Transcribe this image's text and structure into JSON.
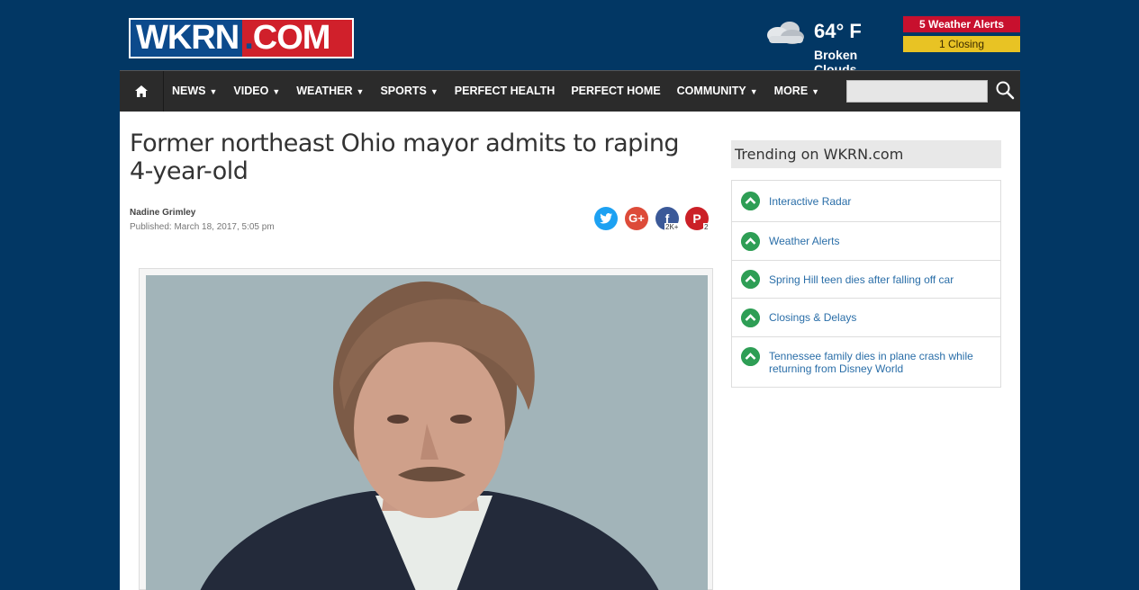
{
  "header": {
    "logo_left": "WKRN",
    "logo_dot": ".",
    "logo_right": "COM",
    "weather_icon": "cloud-icon",
    "temperature": "64° F",
    "condition": "Broken Clouds",
    "alerts_label": "5 Weather Alerts",
    "closings_label": "1 Closing"
  },
  "nav": {
    "home_icon": "home-icon",
    "items": [
      {
        "label": "NEWS",
        "caret": "▼"
      },
      {
        "label": "VIDEO",
        "caret": "▼"
      },
      {
        "label": "WEATHER",
        "caret": "▼"
      },
      {
        "label": "SPORTS",
        "caret": "▼"
      },
      {
        "label": "PERFECT HEALTH",
        "caret": ""
      },
      {
        "label": "PERFECT HOME",
        "caret": ""
      },
      {
        "label": "COMMUNITY",
        "caret": "▼"
      },
      {
        "label": "MORE",
        "caret": "▼"
      }
    ],
    "search_placeholder": "",
    "search_icon": "search-icon"
  },
  "article": {
    "headline": "Former northeast Ohio mayor admits to raping 4-year-old",
    "author": "Nadine Grimley",
    "published": "Published: March 18, 2017, 5:05 pm",
    "share": {
      "twitter": "twitter-icon",
      "google_plus": "G+",
      "facebook": "f",
      "facebook_count": "2K+",
      "pinterest": "P",
      "pinterest_count": "2"
    }
  },
  "sidebar": {
    "title": "Trending on WKRN.com",
    "items": [
      {
        "label": "Interactive Radar"
      },
      {
        "label": "Weather Alerts"
      },
      {
        "label": "Spring Hill teen dies after falling off car"
      },
      {
        "label": "Closings & Delays"
      },
      {
        "label": "Tennessee family dies in plane crash while returning from Disney World"
      }
    ]
  },
  "colors": {
    "page_bg": "#023764",
    "nav_bg": "#2b2b2b",
    "alert_red": "#c8102e",
    "alert_yellow": "#e8c324",
    "trend_icon": "#2e9e55",
    "link": "#2a6ea8"
  }
}
